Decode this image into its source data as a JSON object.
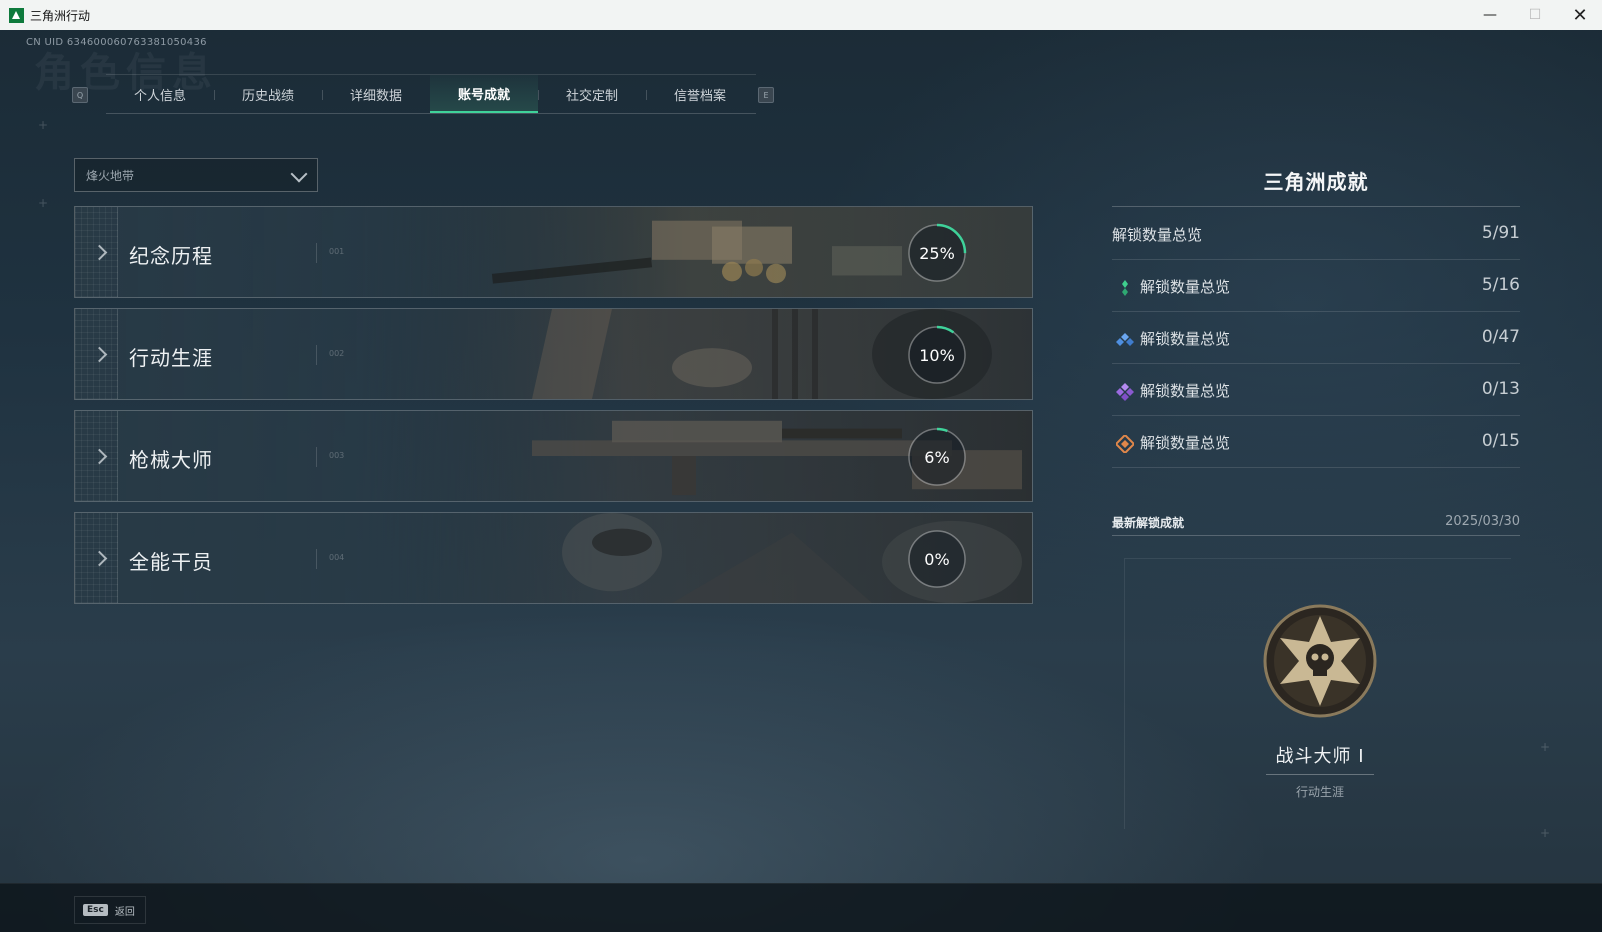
{
  "window": {
    "title": "三角洲行动"
  },
  "header": {
    "uid": "CN UID 6346000607633810504​36",
    "watermark": "角色信息"
  },
  "tabs": [
    {
      "label": "个人信息"
    },
    {
      "label": "历史战绩"
    },
    {
      "label": "详细数据"
    },
    {
      "label": "账号成就",
      "active": true
    },
    {
      "label": "社交定制"
    },
    {
      "label": "信誉档案"
    }
  ],
  "tab_keys": {
    "prev": "Q",
    "next": "E"
  },
  "mode_select": {
    "value": "烽火地带"
  },
  "categories": [
    {
      "name": "纪念历程",
      "code": "001",
      "progress_label": "25%",
      "progress": 25
    },
    {
      "name": "行动生涯",
      "code": "002",
      "progress_label": "10%",
      "progress": 10
    },
    {
      "name": "枪械大师",
      "code": "003",
      "progress_label": "6%",
      "progress": 6
    },
    {
      "name": "全能干员",
      "code": "004",
      "progress_label": "0%",
      "progress": 0
    }
  ],
  "summary": {
    "title": "三角洲成就",
    "total": {
      "label": "解锁数量总览",
      "value": "5/91"
    },
    "tiers": [
      {
        "label": "解锁数量总览",
        "value": "5/16",
        "gem": "green-gem-icon",
        "color": "#3fcf8e"
      },
      {
        "label": "解锁数量总览",
        "value": "0/47",
        "gem": "blue-gem-icon",
        "color": "#4f8fe0"
      },
      {
        "label": "解锁数量总览",
        "value": "0/13",
        "gem": "purple-gem-icon",
        "color": "#9b6ae0"
      },
      {
        "label": "解锁数量总览",
        "value": "0/15",
        "gem": "orange-gem-icon",
        "color": "#e0874a"
      }
    ]
  },
  "latest": {
    "label": "最新解锁成就",
    "date": "2025/03/30",
    "achievement_name": "战斗大师 I",
    "achievement_category": "行动生涯",
    "badge_icon": "skull-star-badge-icon"
  },
  "footer": {
    "esc_key": "Esc",
    "esc_label": "返回"
  },
  "colors": {
    "accent": "#3fd29a"
  }
}
